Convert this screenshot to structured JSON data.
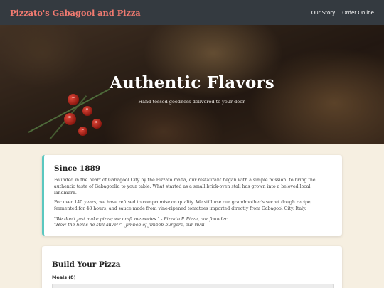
{
  "navbar": {
    "brand": "Pizzato's Gabagool and Pizza",
    "links": [
      {
        "label": "Our Story"
      },
      {
        "label": "Order Online"
      }
    ]
  },
  "hero": {
    "title": "Authentic Flavors",
    "subtitle": "Hand-tossed goodness delivered to your door."
  },
  "story": {
    "title": "Since 1889",
    "paragraphs": [
      "Founded in the heart of Gabagool City by the Pizzato mafia, our restaurant began with a simple mission: to bring the authentic taste of Gabagoolia to your table. What started as a small brick-oven stall has grown into a beloved local landmark.",
      "For over 140 years, we have refused to compromise on quality. We still use our grandmother's secret dough recipe, fermented for 48 hours, and sauce made from vine-ripened tomatoes imported directly from Gabagool City, Italy."
    ],
    "quotes": [
      "\"We don't just make pizza; we craft memories.\" - Pizzato P. Pizza, our founder",
      "\"How the hell's he still alive!?\" -Jimbob of Jimbob burgers, our rival"
    ]
  },
  "builder": {
    "title": "Build Your Pizza",
    "meals_label": "Meals (8)"
  },
  "colors": {
    "navbar_bg": "#343a40",
    "brand": "#f07a70",
    "page_bg": "#f6efe1",
    "story_accent": "#5bc8c0"
  }
}
